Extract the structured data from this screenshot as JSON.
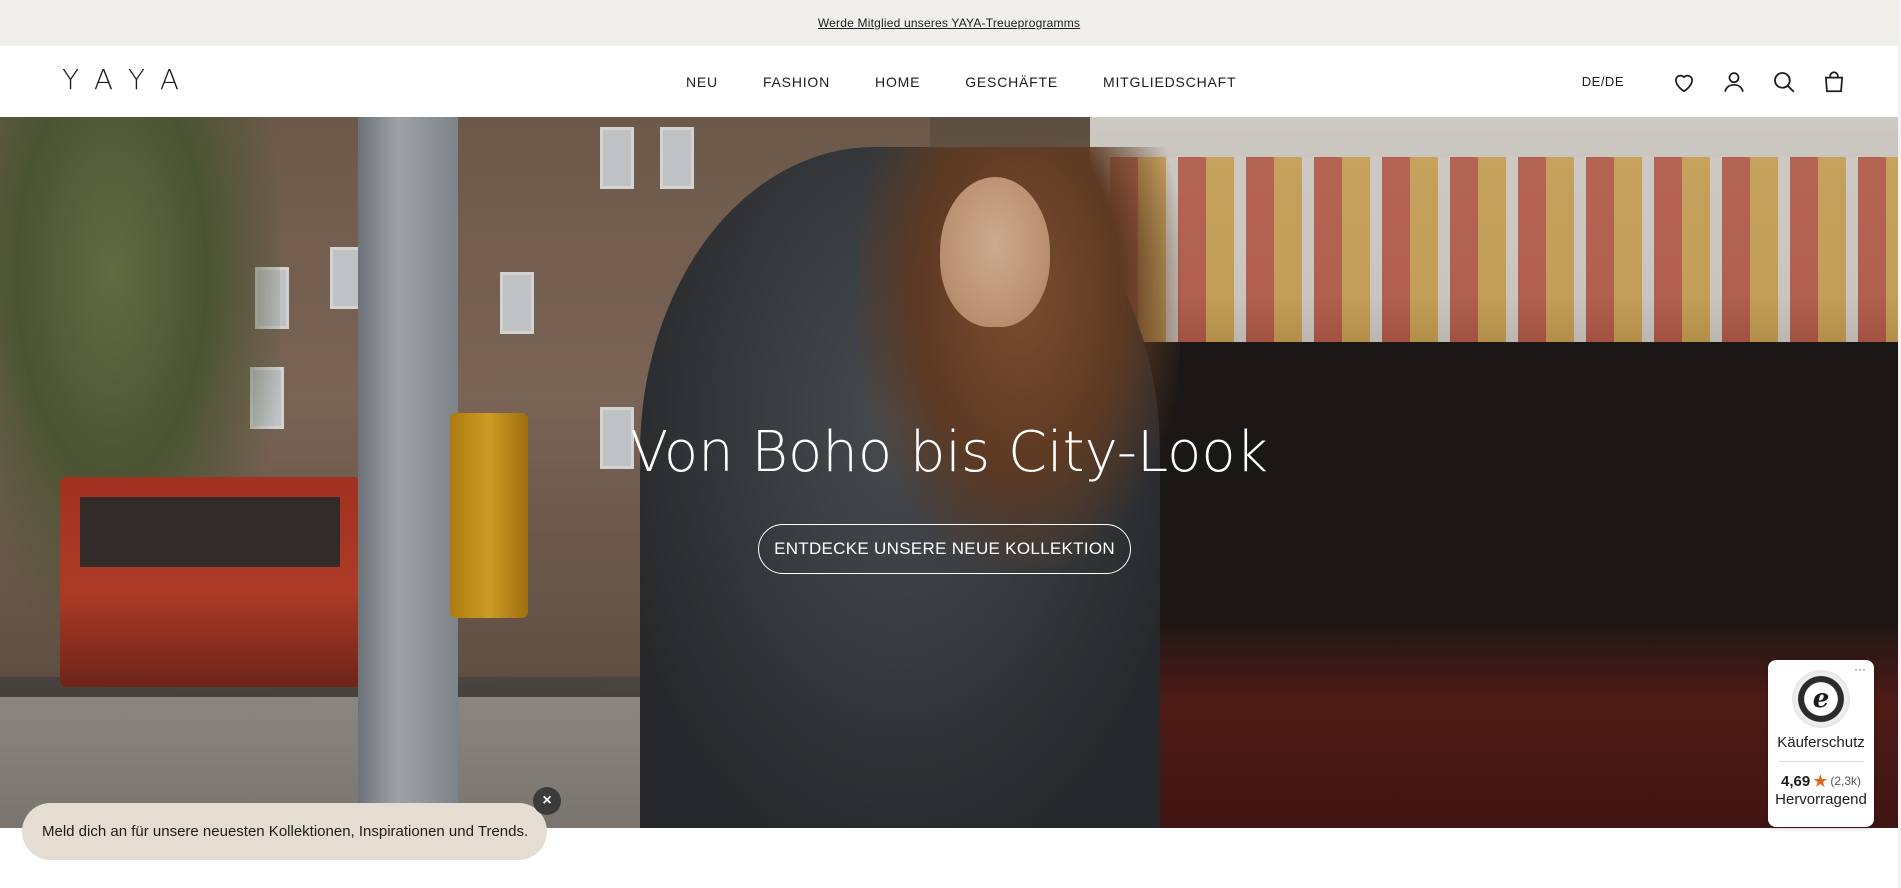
{
  "announcement": {
    "text": "Werde Mitglied unseres YAYA-Treueprogramms"
  },
  "header": {
    "logo": "YAYA",
    "nav": [
      "NEU",
      "FASHION",
      "HOME",
      "GESCHÄFTE",
      "MITGLIEDSCHAFT"
    ],
    "locale": "DE/DE",
    "icons": [
      "heart-icon",
      "user-icon",
      "search-icon",
      "bag-icon"
    ]
  },
  "hero": {
    "title": "Von Boho bis City-Look",
    "cta": "ENTDECKE UNSERE NEUE KOLLEKTION"
  },
  "newsletter": {
    "text": "Meld dich an für unsere neuesten Kollektionen, Inspirationen und Trends.",
    "close": "×"
  },
  "trusted_shops": {
    "seal_letter": "e",
    "protection": "Käuferschutz",
    "rating": "4,69",
    "count": "(2,3k)",
    "label": "Hervorragend",
    "more": "···"
  },
  "colors": {
    "announcement_bg": "#f0efeb",
    "newsletter_bg": "#e6ddd2",
    "star": "#e06b1f"
  }
}
